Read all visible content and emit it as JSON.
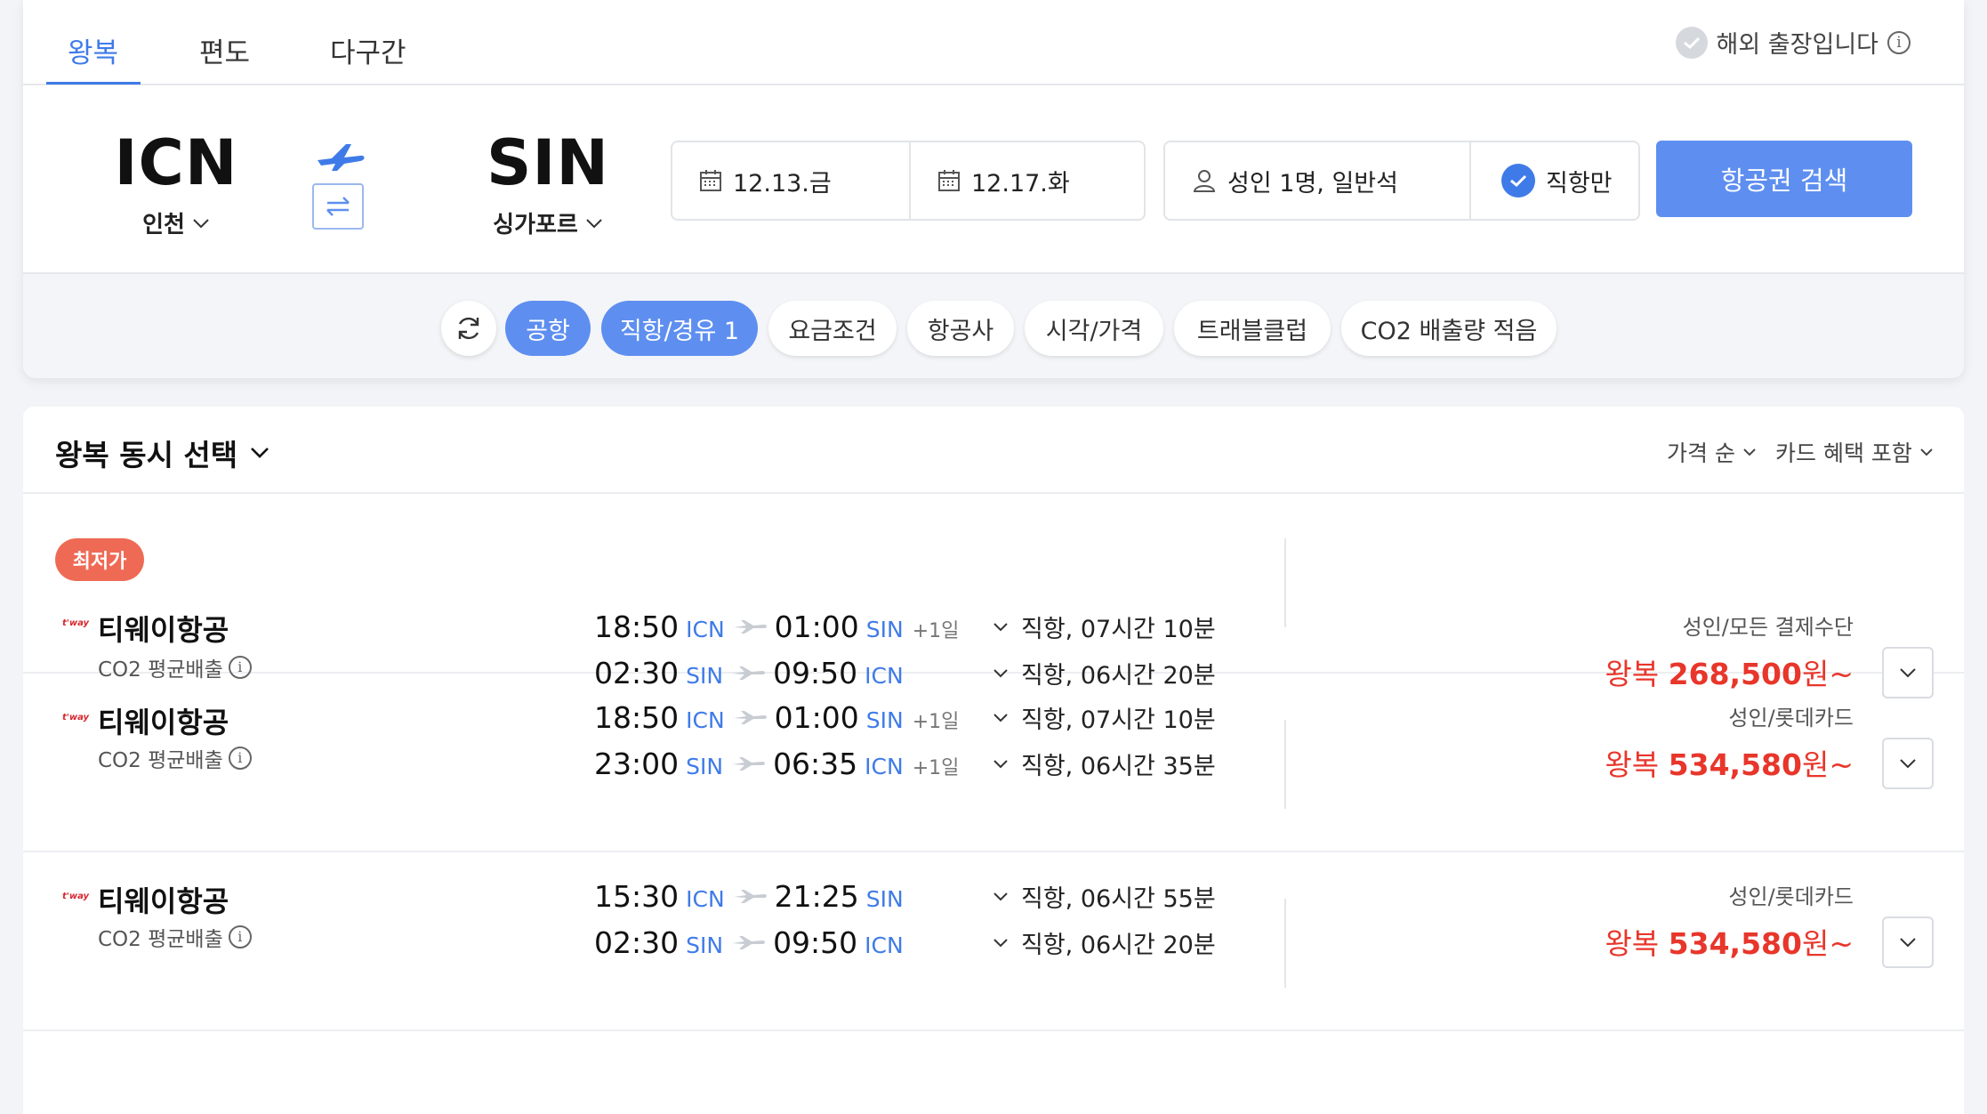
{
  "tabs": [
    {
      "label": "왕복",
      "active": true
    },
    {
      "label": "편도",
      "active": false
    },
    {
      "label": "다구간",
      "active": false
    }
  ],
  "overseas": {
    "label": "해외 출장입니다"
  },
  "route": {
    "origin": {
      "code": "ICN",
      "name": "인천"
    },
    "destination": {
      "code": "SIN",
      "name": "싱가포르"
    }
  },
  "dates": {
    "depart": "12.13.금",
    "return": "12.17.화"
  },
  "passengers": {
    "label": "성인 1명, 일반석"
  },
  "direct_only": {
    "label": "직항만",
    "checked": true
  },
  "search_button": {
    "label": "항공권 검색"
  },
  "filters": [
    {
      "label": "공항",
      "active": true
    },
    {
      "label": "직항/경유 1",
      "active": true
    },
    {
      "label": "요금조건",
      "active": false
    },
    {
      "label": "항공사",
      "active": false
    },
    {
      "label": "시각/가격",
      "active": false
    },
    {
      "label": "트래블클럽",
      "active": false
    },
    {
      "label": "CO2 배출량 적음",
      "active": false
    }
  ],
  "results": {
    "title": "왕복 동시 선택",
    "sort": "가격 순",
    "card_option": "카드 혜택 포함",
    "badge": "최저가",
    "flights": [
      {
        "airline": "티웨이항공",
        "logo_text": "t'way",
        "co2": "CO2 평균배출",
        "outbound": {
          "dep_time": "18:50",
          "dep_ap": "ICN",
          "arr_time": "01:00",
          "arr_ap": "SIN",
          "plus": "+1일",
          "info": "직항, 07시간 10분"
        },
        "inbound": {
          "dep_time": "02:30",
          "dep_ap": "SIN",
          "arr_time": "09:50",
          "arr_ap": "ICN",
          "plus": "",
          "info": "직항, 06시간 20분"
        },
        "price_label": "성인/모든 결제수단",
        "price_prefix": "왕복",
        "price_amount": "268,500",
        "price_suffix": "원~"
      },
      {
        "airline": "티웨이항공",
        "logo_text": "t'way",
        "co2": "CO2 평균배출",
        "outbound": {
          "dep_time": "18:50",
          "dep_ap": "ICN",
          "arr_time": "01:00",
          "arr_ap": "SIN",
          "plus": "+1일",
          "info": "직항, 07시간 10분"
        },
        "inbound": {
          "dep_time": "23:00",
          "dep_ap": "SIN",
          "arr_time": "06:35",
          "arr_ap": "ICN",
          "plus": "+1일",
          "info": "직항, 06시간 35분"
        },
        "price_label": "성인/롯데카드",
        "price_prefix": "왕복",
        "price_amount": "534,580",
        "price_suffix": "원~"
      },
      {
        "airline": "티웨이항공",
        "logo_text": "t'way",
        "co2": "CO2 평균배출",
        "outbound": {
          "dep_time": "15:30",
          "dep_ap": "ICN",
          "arr_time": "21:25",
          "arr_ap": "SIN",
          "plus": "",
          "info": "직항, 06시간 55분"
        },
        "inbound": {
          "dep_time": "02:30",
          "dep_ap": "SIN",
          "arr_time": "09:50",
          "arr_ap": "ICN",
          "plus": "",
          "info": "직항, 06시간 20분"
        },
        "price_label": "성인/롯데카드",
        "price_prefix": "왕복",
        "price_amount": "534,580",
        "price_suffix": "원~"
      }
    ]
  },
  "colors": {
    "accent": "#3f7be8",
    "button": "#5e8ff0",
    "price": "#e8362b",
    "badge": "#ef6a55"
  }
}
